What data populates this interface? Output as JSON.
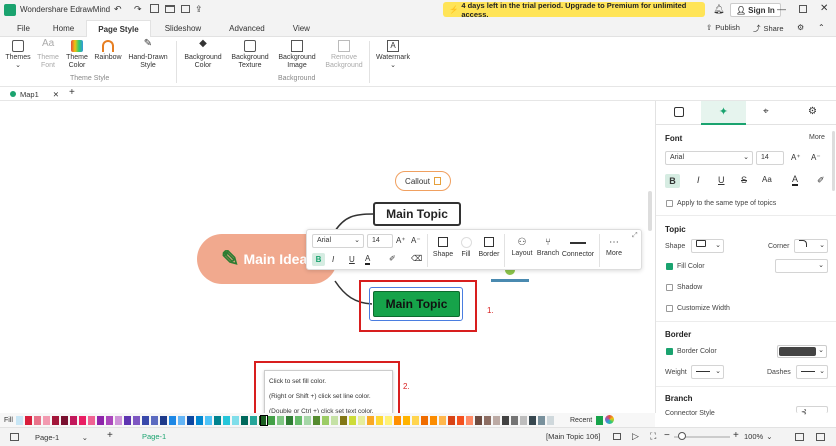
{
  "app": {
    "title": "Wondershare EdrawMind",
    "trial_banner": "4 days left in the trial period. Upgrade to Premium for unlimited access.",
    "sign_in": "Sign In",
    "publish": "Publish",
    "share": "Share"
  },
  "menu_tabs": [
    "File",
    "Home",
    "Page Style",
    "Slideshow",
    "Advanced",
    "View"
  ],
  "ribbon": {
    "themes": "Themes",
    "theme_font": [
      "Theme",
      "Font"
    ],
    "theme_color": [
      "Theme",
      "Color"
    ],
    "rainbow": "Rainbow",
    "hand_drawn": [
      "Hand-Drawn",
      "Style"
    ],
    "theme_style_group": "Theme Style",
    "bg_color": [
      "Background",
      "Color"
    ],
    "bg_texture": [
      "Background",
      "Texture"
    ],
    "bg_image": [
      "Background",
      "Image"
    ],
    "remove_bg": [
      "Remove",
      "Background"
    ],
    "background_group": "Background",
    "watermark": "Watermark"
  },
  "doc_tab": "Map1",
  "canvas": {
    "callout": "Callout",
    "main_topic_top": "Main Topic",
    "main_idea": "Main Idea",
    "main_topic_selected": "Main Topic",
    "label_1": "1.",
    "label_2": "2."
  },
  "float_toolbar": {
    "font": "Arial",
    "size": "14",
    "shape": "Shape",
    "fill": "Fill",
    "border": "Border",
    "layout": "Layout",
    "branch": "Branch",
    "connector": "Connector",
    "more": "More"
  },
  "tooltip": [
    "Click to set fill color.",
    "(Right or Shift +) click set line color.",
    "(Double or Ctrl +) click set text color."
  ],
  "colorbar": {
    "fill_label": "Fill",
    "recent_label": "Recent",
    "colors": [
      "#c8e6f5",
      "#d81e3c",
      "#e8738a",
      "#f29ab0",
      "#a3163a",
      "#7a1030",
      "#c2185b",
      "#e91e63",
      "#f06292",
      "#8e24aa",
      "#ab47bc",
      "#ce93d8",
      "#5e35b1",
      "#7e57c2",
      "#3949ab",
      "#5c6bc0",
      "#1e3a8a",
      "#1e88e5",
      "#64b5f6",
      "#0d47a1",
      "#0288d1",
      "#4fc3f7",
      "#00838f",
      "#26c6da",
      "#80deea",
      "#00695c",
      "#26a69a",
      "#1b5e20",
      "#43a047",
      "#81c784",
      "#2e7d32",
      "#66bb6a",
      "#a5d6a7",
      "#558b2f",
      "#9ccc65",
      "#c5e1a5",
      "#827717",
      "#cddc39",
      "#e6ee9c",
      "#f9a825",
      "#fdd835",
      "#fff176",
      "#ff8f00",
      "#ffb300",
      "#ffd54f",
      "#ef6c00",
      "#fb8c00",
      "#ffb74d",
      "#d84315",
      "#f4511e",
      "#ff8a65",
      "#6d4c41",
      "#8d6e63",
      "#bcaaa4",
      "#424242",
      "#757575",
      "#bdbdbd",
      "#37474f",
      "#78909c",
      "#cfd8dc"
    ]
  },
  "panel": {
    "font_header": "Font",
    "more": "More",
    "font_name": "Arial",
    "font_size": "14",
    "apply_same": "Apply to the same type of topics",
    "topic_header": "Topic",
    "shape": "Shape",
    "corner": "Corner",
    "fill_color": "Fill Color",
    "shadow": "Shadow",
    "custom_width": "Customize Width",
    "border_header": "Border",
    "border_color": "Border Color",
    "weight": "Weight",
    "dashes": "Dashes",
    "branch_header": "Branch",
    "connector_style": "Connector Style",
    "border_color_value": "#444444"
  },
  "status": {
    "page_select": "Page-1",
    "page_tab": "Page-1",
    "selection": "[Main Topic 106]",
    "zoom": "100%"
  }
}
